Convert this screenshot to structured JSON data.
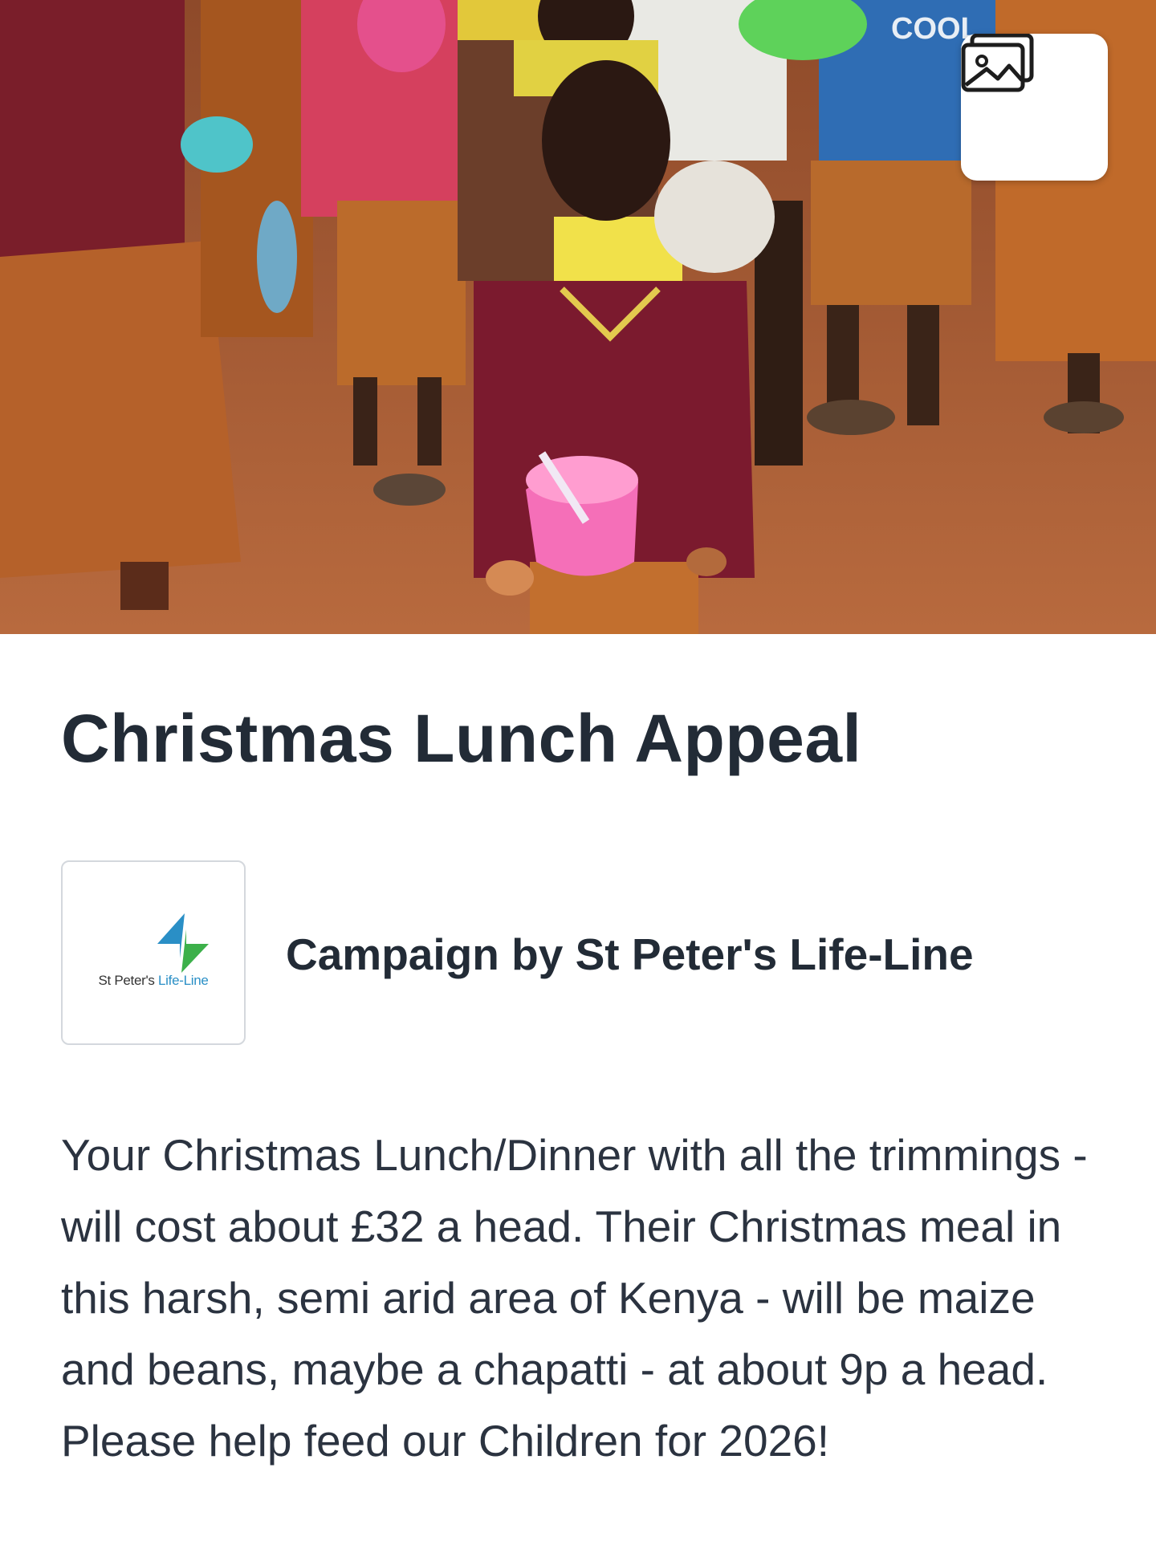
{
  "hero": {
    "shirt_text": "COOL",
    "gallery_button": {
      "icon": "image-gallery-icon"
    }
  },
  "campaign": {
    "title": "Christmas Lunch Appeal",
    "organizer_prefix": "Campaign by",
    "organizer_name": "St Peter's Life-Line",
    "logo": {
      "text_main": "St Peter's ",
      "text_accent": "Life-Line",
      "icon": "lightning-bolt-logo"
    },
    "description": "Your Christmas Lunch/Dinner with all the trimmings - will cost about £32 a head. Their Christmas meal in this harsh, semi arid area of Kenya - will be maize and beans, maybe a chapatti - at about 9p a head. Please help feed our Children for 2026!"
  },
  "colors": {
    "text": "#222b36",
    "logo_blue": "#2a8fc6",
    "logo_green": "#3cb04a",
    "ground": "#a85a33"
  }
}
